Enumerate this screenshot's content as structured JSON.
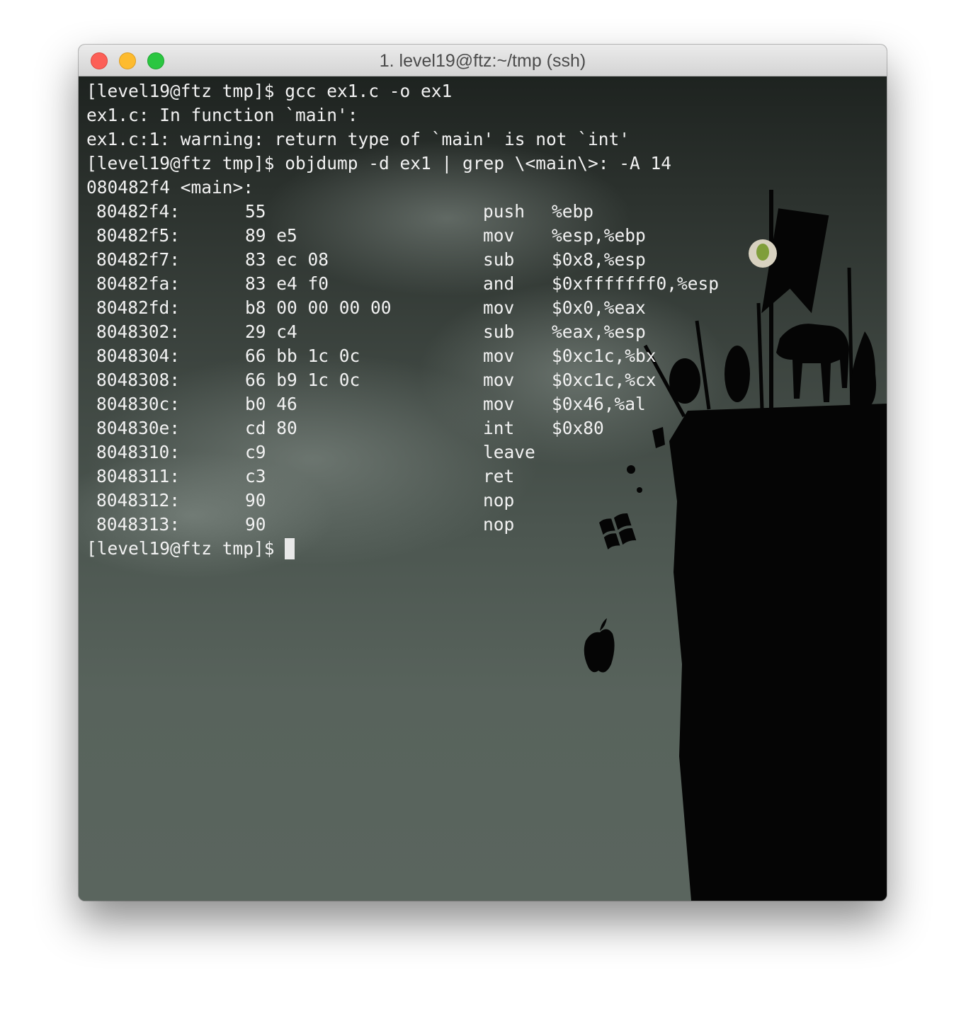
{
  "window": {
    "title": "1. level19@ftz:~/tmp (ssh)"
  },
  "terminal": {
    "header_lines": [
      "[level19@ftz tmp]$ gcc ex1.c -o ex1",
      "ex1.c: In function `main':",
      "ex1.c:1: warning: return type of `main' is not `int'",
      "[level19@ftz tmp]$ objdump -d ex1 | grep \\<main\\>: -A 14",
      "080482f4 <main>:"
    ],
    "disassembly": [
      {
        "addr": "80482f4:",
        "bytes": "55",
        "mnemonic": "push",
        "operands": "%ebp"
      },
      {
        "addr": "80482f5:",
        "bytes": "89 e5",
        "mnemonic": "mov",
        "operands": "%esp,%ebp"
      },
      {
        "addr": "80482f7:",
        "bytes": "83 ec 08",
        "mnemonic": "sub",
        "operands": "$0x8,%esp"
      },
      {
        "addr": "80482fa:",
        "bytes": "83 e4 f0",
        "mnemonic": "and",
        "operands": "$0xfffffff0,%esp"
      },
      {
        "addr": "80482fd:",
        "bytes": "b8 00 00 00 00",
        "mnemonic": "mov",
        "operands": "$0x0,%eax"
      },
      {
        "addr": "8048302:",
        "bytes": "29 c4",
        "mnemonic": "sub",
        "operands": "%eax,%esp"
      },
      {
        "addr": "8048304:",
        "bytes": "66 bb 1c 0c",
        "mnemonic": "mov",
        "operands": "$0xc1c,%bx"
      },
      {
        "addr": "8048308:",
        "bytes": "66 b9 1c 0c",
        "mnemonic": "mov",
        "operands": "$0xc1c,%cx"
      },
      {
        "addr": "804830c:",
        "bytes": "b0 46",
        "mnemonic": "mov",
        "operands": "$0x46,%al"
      },
      {
        "addr": "804830e:",
        "bytes": "cd 80",
        "mnemonic": "int",
        "operands": "$0x80"
      },
      {
        "addr": "8048310:",
        "bytes": "c9",
        "mnemonic": "leave",
        "operands": ""
      },
      {
        "addr": "8048311:",
        "bytes": "c3",
        "mnemonic": "ret",
        "operands": ""
      },
      {
        "addr": "8048312:",
        "bytes": "90",
        "mnemonic": "nop",
        "operands": ""
      },
      {
        "addr": "8048313:",
        "bytes": "90",
        "mnemonic": "nop",
        "operands": ""
      }
    ],
    "prompt": "[level19@ftz tmp]$"
  }
}
